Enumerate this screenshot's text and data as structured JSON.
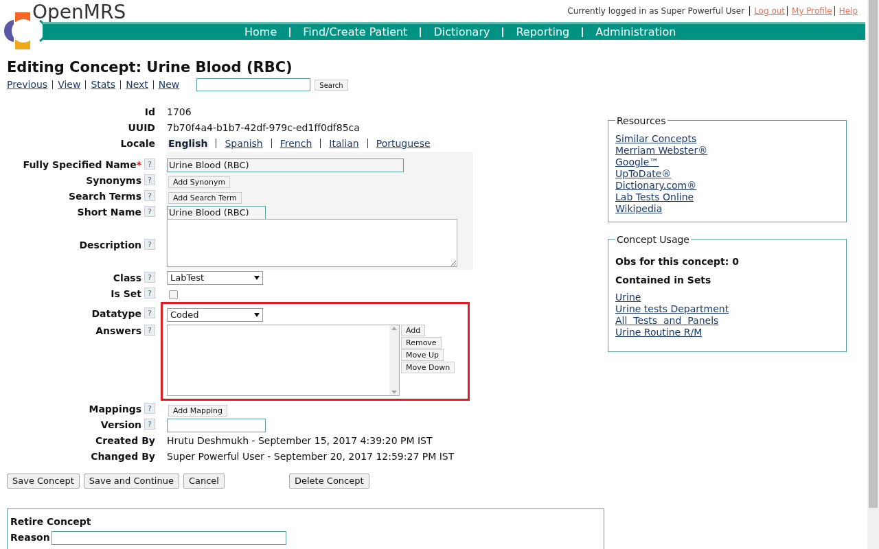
{
  "header": {
    "logo_text": "OpenMRS",
    "login_text": "Currently logged in as Super Powerful User",
    "user_links": [
      "Log out",
      "My Profile",
      "Help"
    ]
  },
  "nav": [
    "Home",
    "Find/Create Patient",
    "Dictionary",
    "Reporting",
    "Administration"
  ],
  "title": "Editing Concept: Urine Blood (RBC)",
  "concept_links": [
    "Previous",
    "View",
    "Stats",
    "Next",
    "New"
  ],
  "search": {
    "button": "Search"
  },
  "fields": [
    {
      "kind": "text",
      "label": "Id",
      "value": "1706"
    },
    {
      "kind": "text",
      "label": "UUID",
      "value": "7b70f4a4-b1b7-42df-979c-ed1ff0df85ca"
    },
    {
      "kind": "locale",
      "label": "Locale",
      "locales": [
        {
          "label": "English",
          "selected": true
        },
        {
          "label": "Spanish",
          "selected": false
        },
        {
          "label": "French",
          "selected": false
        },
        {
          "label": "Italian",
          "selected": false
        },
        {
          "label": "Portuguese",
          "selected": false
        }
      ]
    },
    {
      "kind": "names",
      "fields": [
        {
          "kind": "input",
          "label": "Fully Specified Name",
          "marker": "*",
          "help": "?",
          "value": "Urine Blood (RBC)",
          "wide": true
        },
        {
          "kind": "button",
          "label": "Synonyms",
          "help": "?",
          "button": "Add Synonym"
        },
        {
          "kind": "button",
          "label": "Search Terms",
          "help": "?",
          "button": "Add Search Term"
        },
        {
          "kind": "input",
          "label": "Short Name",
          "help": "?",
          "value": "Urine Blood (RBC)"
        },
        {
          "kind": "textarea",
          "label": "Description",
          "help": "?"
        }
      ]
    },
    {
      "kind": "select",
      "label": "Class",
      "help": "?",
      "value": "LabTest"
    },
    {
      "kind": "checkbox",
      "label": "Is Set",
      "help": "?",
      "checked": false
    },
    {
      "kind": "group",
      "highlighted": true,
      "fields": [
        {
          "kind": "select",
          "label": "Datatype",
          "help": "?",
          "value": "Coded"
        },
        {
          "kind": "answers",
          "label": "Answers",
          "help": "?",
          "buttons": [
            "Add",
            "Remove",
            "Move Up",
            "Move Down"
          ]
        }
      ]
    },
    {
      "kind": "button",
      "label": "Mappings",
      "help": "?",
      "button": "Add Mapping"
    },
    {
      "kind": "input",
      "label": "Version",
      "help": "?"
    },
    {
      "kind": "text",
      "label": "Created By",
      "value": "Hrutu Deshmukh - September 15, 2017 4:39:20 PM IST"
    },
    {
      "kind": "text",
      "label": "Changed By",
      "value": "Super Powerful User - September 20, 2017 12:59:27 PM IST"
    }
  ],
  "actions": [
    "Save Concept",
    "Save and Continue",
    "Cancel",
    "Delete Concept"
  ],
  "retire": {
    "title": "Retire Concept",
    "reason_label": "Reason"
  },
  "resources": {
    "title": "Resources",
    "links": [
      "Similar Concepts",
      "Merriam Webster®",
      "Google™",
      "UpToDate®",
      "Dictionary.com®",
      "Lab Tests Online",
      "Wikipedia"
    ]
  },
  "usage": {
    "title": "Concept Usage",
    "obs": "Obs for this concept: 0",
    "sets_title": "Contained in Sets",
    "sets": [
      "Urine",
      "Urine tests Department",
      "All  Tests  and  Panels",
      "Urine Routine R/M"
    ]
  }
}
